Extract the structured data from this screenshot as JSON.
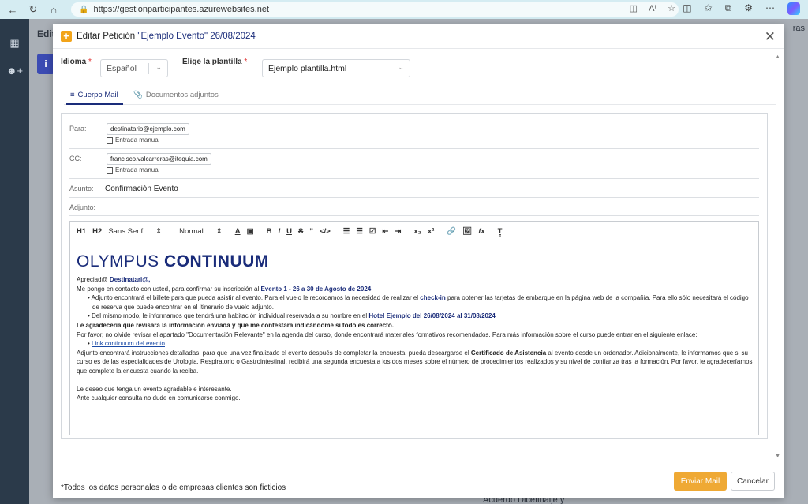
{
  "browser": {
    "url": "https://gestionparticipantes.azurewebsites.net",
    "icons": [
      "back-icon",
      "refresh-icon",
      "home-icon",
      "lock-icon",
      "favorites-icon",
      "copilot-icon"
    ]
  },
  "background_app": {
    "title": "Edit",
    "right_text": "ras",
    "info_letter": "i",
    "bottom_text": "Acuerdo Dicefinalje y"
  },
  "modal": {
    "title_prefix": "Editar Petición",
    "title_event": "\"Ejemplo Evento\" 26/08/2024",
    "idioma": {
      "label": "Idioma",
      "required_mark": "*",
      "value": "Español"
    },
    "plantilla": {
      "label": "Elige la plantilla",
      "required_mark": "*",
      "value": "Ejemplo plantilla.html"
    },
    "tabs": [
      {
        "label": "Cuerpo Mail",
        "icon": "lines-icon",
        "active": true
      },
      {
        "label": "Documentos adjuntos",
        "icon": "paperclip-icon",
        "active": false
      }
    ],
    "para": {
      "label": "Para:",
      "value": "destinatario@ejemplo.com",
      "checkbox_label": "Entrada manual",
      "checked": false
    },
    "cc": {
      "label": "CC:",
      "value": "francisco.valcarreras@itequia.com",
      "checkbox_label": "Entrada manual",
      "checked": false
    },
    "asunto": {
      "label": "Asunto:",
      "value": "Confirmación Evento"
    },
    "adjunto": {
      "label": "Adjunto:"
    },
    "toolbar": {
      "h1": "H1",
      "h2": "H2",
      "font": "Sans Serif",
      "size": "Normal",
      "buttons": [
        "A",
        "A",
        "B",
        "I",
        "U",
        "S",
        "99",
        "</>",
        "ol",
        "ul",
        "check",
        "outdent",
        "indent",
        "x2",
        "x2",
        "link",
        "image",
        "fx",
        "Tx"
      ]
    },
    "body": {
      "logo_light": "OLYMPUS ",
      "logo_bold": "CONTINUUM",
      "greeting": "Apreciad@ ",
      "greeting_name": "Destinatari@,",
      "p1": "Me pongo en contacto con usted, para confirmar su inscripción al ",
      "p1_hl": "Evento 1 - 26 a 30 de Agosto de 2024",
      "b1a": "Adjunto encontrará el billete para que pueda asistir al evento. Para el vuelo le recordamos la necesidad de realizar el ",
      "b1_hl": "check-in",
      "b1b": " para obtener las tarjetas de embarque en la página web de la compañía. Para ello sólo necesitará el código de reserva que puede encontrar en el Itinerario de vuelo adjunto.",
      "b2a": "Del mismo modo, le informamos que tendrá una habitación individual reservada a su nombre en el ",
      "b2_hl": "Hotel Ejemplo del 26/08/2024 al 31/08/2024",
      "p2": "Le agradeceria que revisara la información enviada y que me contestara indicándome si todo es correcto.",
      "p3": "Por favor, no olvide revisar el apartado \"Documentación Relevante\" en la agenda del curso, donde encontrará materiales formativos recomendados. Para más información sobre el curso puede entrar en el siguiente enlace:",
      "link": "Link continuum del evento",
      "p4a": "Adjunto encontrará instrucciones detalladas, para que una vez finalizado el evento después de completar la encuesta, pueda descargarse el ",
      "p4_bold": "Certificado de Asistencia",
      "p4b": " al evento desde un ordenador. Adicionalmente, le informamos que si su curso es de las especialidades de Urología, Respiratorio o Gastrointestinal, recibirá una segunda encuesta a los dos meses sobre el número de procedimientos realizados y su nivel de confianza tras la formación. Por favor, le agradeceríamos que complete la encuesta cuando la reciba.",
      "p5": "Le deseo que tenga un evento agradable e interesante.",
      "p6": "Ante cualquier consulta no dude en comunicarse conmigo."
    },
    "footer_note": "*Todos los datos personales o de empresas clientes son ficticios",
    "send_label": "Enviar Mail",
    "cancel_label": "Cancelar"
  }
}
